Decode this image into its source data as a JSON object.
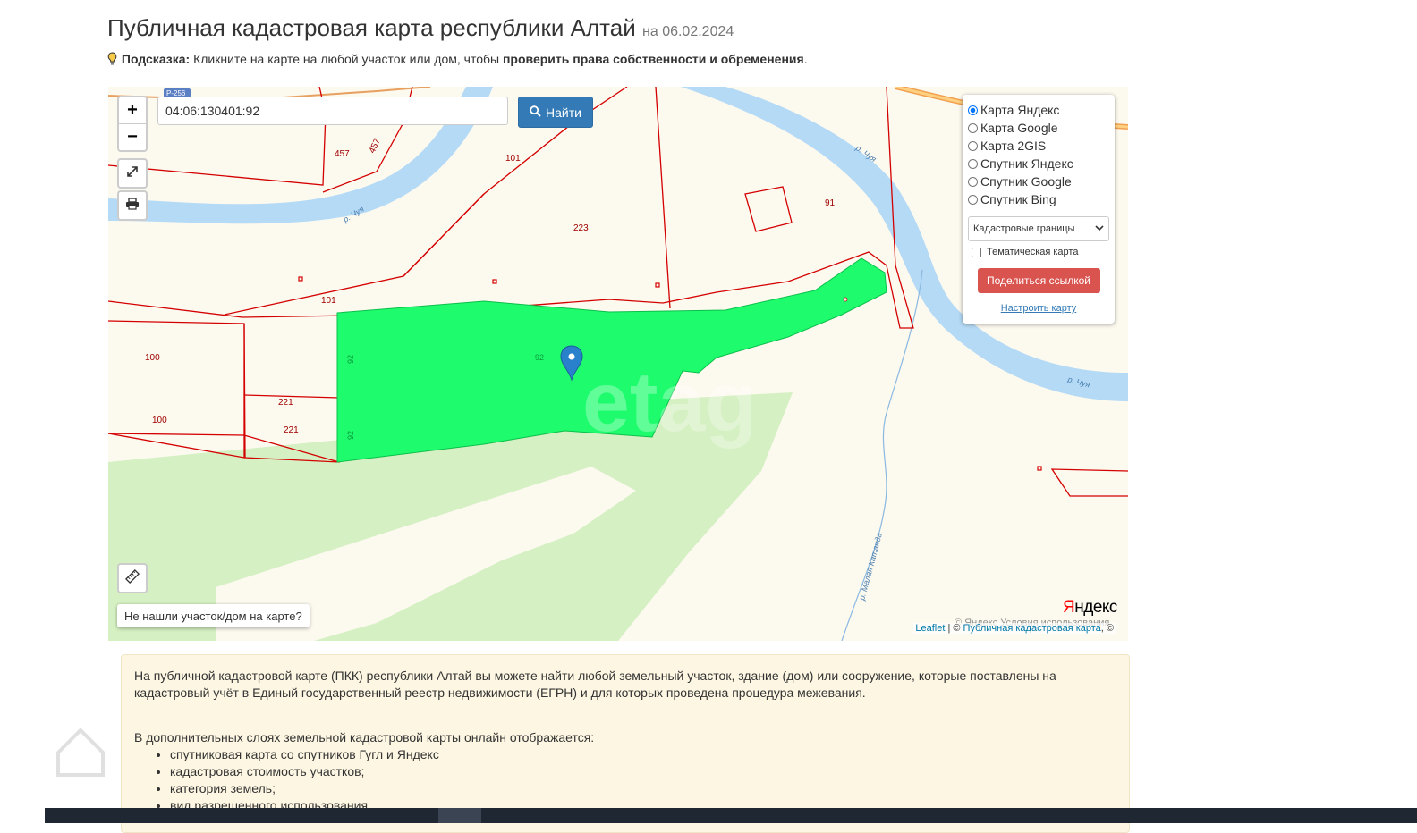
{
  "page": {
    "title": "Публичная кадастровая карта республики Алтай",
    "date_prefix": "на",
    "date": "06.02.2024",
    "hint_label": "Подсказка:",
    "hint_text": "Кликните на карте на любой участок или дом, чтобы",
    "hint_bold": "проверить права собственности и обременения",
    "hint_end": "."
  },
  "search": {
    "value": "04:06:130401:92",
    "button_label": "Найти"
  },
  "zoom": {
    "in": "+",
    "out": "−"
  },
  "layers": {
    "options": [
      "Карта Яндекс",
      "Карта Google",
      "Карта 2GIS",
      "Спутник Яндекс",
      "Спутник Google",
      "Спутник Bing"
    ],
    "selected": "Карта Яндекс",
    "overlay_select": "Кадастровые границы",
    "thematic_label": "Тематическая карта",
    "share_button": "Поделиться ссылкой",
    "setup_link": "Настроить карту"
  },
  "map": {
    "not_found_button": "Не нашли участок/дом на карте?",
    "parcel_labels": [
      "457",
      "457",
      "101",
      "223",
      "91",
      "101",
      "100",
      "100",
      "221",
      "221",
      "92",
      "92",
      "92"
    ],
    "river_labels": [
      "р. Чуя",
      "р. Чуя",
      "р. Чуя",
      "р. Малая Катанда"
    ],
    "road_label": "Р-256",
    "watermark": "etag",
    "yandex_logo_y": "Я",
    "yandex_logo_rest": "ндекс",
    "yandex_copy": "© Яндекс Условия использования",
    "attribution_leaflet": "Leaflet",
    "attribution_sep": "| ©",
    "attribution_pkk": "Публичная кадастровая карта",
    "attribution_end": ", ©"
  },
  "info": {
    "para1": "На публичной кадастровой карте (ПКК) республики Алтай вы можете найти любой земельный участок, здание (дом) или сооружение, которые поставлены на кадастровый учёт в Единый государственный реестр недвижимости (ЕГРН) и для которых проведена процедура межевания.",
    "para2": "В дополнительных слоях земельной кадастровой карты онлайн отображается:",
    "items": [
      "спутниковая карта со спутников Гугл и Яндекс",
      "кадастровая стоимость участков;",
      "категория земель;",
      "вид разрешенного использования"
    ]
  },
  "colors": {
    "parcel_fill": "#1efc6e",
    "boundary": "#d40000",
    "river": "#b5daf6",
    "forest": "#d5f0c2",
    "accent_button": "#337ab7",
    "share_button": "#d9534f"
  }
}
